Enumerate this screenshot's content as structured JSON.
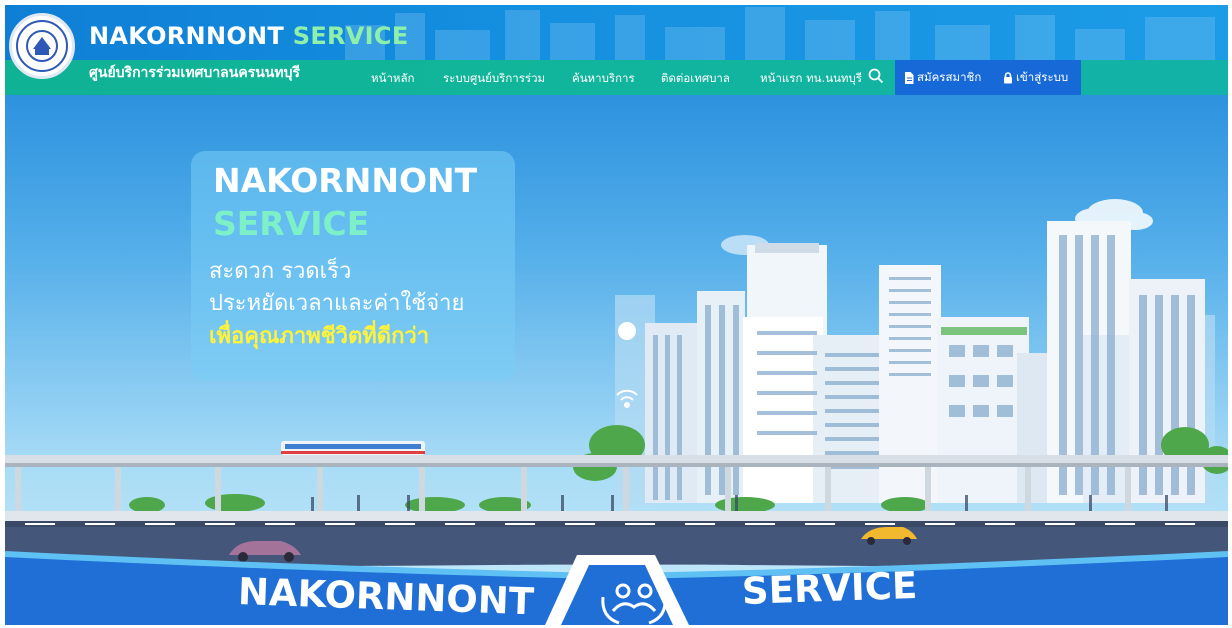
{
  "header": {
    "brand_main": "NAKORNNONT",
    "brand_accent": "SERVICE",
    "subtitle": "ศูนย์บริการร่วมเทศบาลนครนนทบุรี",
    "logo_icon": "city-seal-logo"
  },
  "nav": {
    "items": [
      {
        "label": "หน้าหลัก"
      },
      {
        "label": "ระบบศูนย์บริการร่วม"
      },
      {
        "label": "ค้นหาบริการ"
      },
      {
        "label": "ติดต่อเทศบาล"
      },
      {
        "label": "หน้าแรก ทน.นนทบุรี"
      }
    ],
    "search_icon": "search-icon",
    "register_label": "สมัครสมาชิก",
    "register_icon": "document-icon",
    "login_label": "เข้าสู่ระบบ",
    "login_icon": "lock-icon"
  },
  "hero": {
    "title_line1": "NAKORNNONT",
    "title_line2": "SERVICE",
    "tagline1": "สะดวก รวดเร็ว",
    "tagline2": "ประหยัดเวลาและค่าใช้จ่าย",
    "tagline3": "เพื่อคุณภาพชีวิตที่ดีกว่า",
    "bottom_left": "NAKORNNONT",
    "bottom_right": "SERVICE",
    "badge_icon": "people-hands-icon"
  },
  "colors": {
    "header_blue": "#1590e0",
    "header_green": "#11b59a",
    "accent_green": "#8ef0a9",
    "highlight_yellow": "#fff23a",
    "user_box": "#1769d8"
  }
}
